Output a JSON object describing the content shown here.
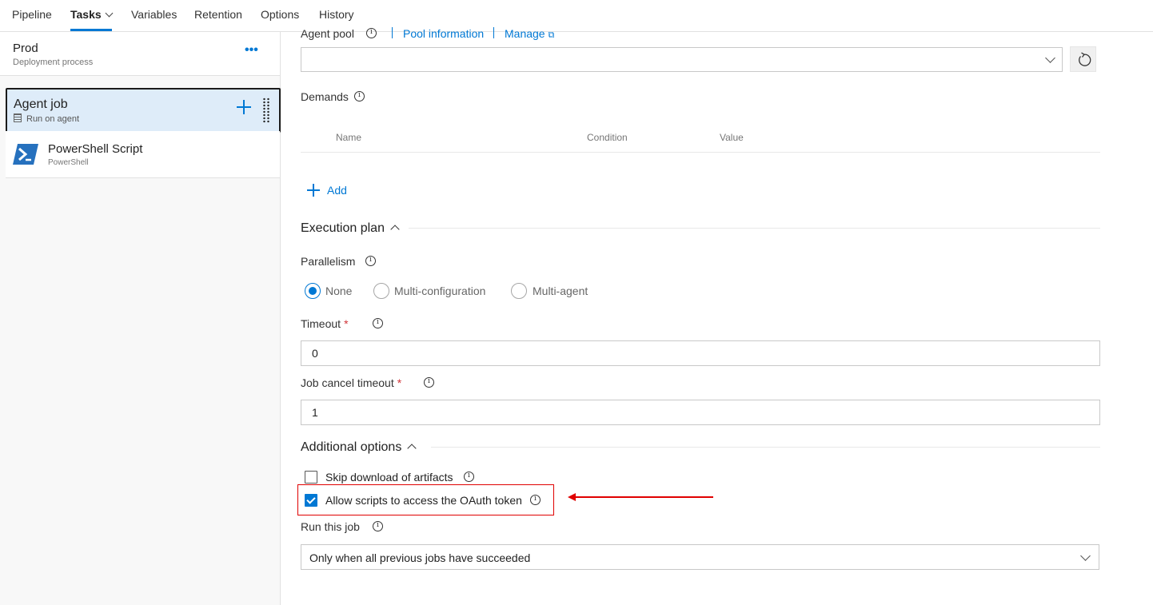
{
  "tabs": [
    {
      "label": "Pipeline"
    },
    {
      "label": "Tasks"
    },
    {
      "label": "Variables"
    },
    {
      "label": "Retention"
    },
    {
      "label": "Options"
    },
    {
      "label": "History"
    }
  ],
  "active_tab": "Tasks",
  "left": {
    "stage_name": "Prod",
    "stage_sub": "Deployment process",
    "more_icon": "ellipsis-icon",
    "agent_job": {
      "title": "Agent job",
      "subtitle": "Run on agent"
    },
    "task": {
      "title": "PowerShell Script",
      "subtitle": "PowerShell"
    }
  },
  "agent_pool": {
    "label": "Agent pool",
    "pool_info_link": "Pool information",
    "manage_link": "Manage",
    "value": ""
  },
  "demands": {
    "label": "Demands",
    "columns": [
      "Name",
      "Condition",
      "Value"
    ],
    "add_label": "Add"
  },
  "execution_plan": {
    "title": "Execution plan",
    "parallelism_label": "Parallelism",
    "options": [
      "None",
      "Multi-configuration",
      "Multi-agent"
    ],
    "selected": "None",
    "timeout_label": "Timeout",
    "timeout_value": "0",
    "cancel_timeout_label": "Job cancel timeout",
    "cancel_timeout_value": "1",
    "required_marker": "*"
  },
  "additional_options": {
    "title": "Additional options",
    "skip_download_label": "Skip download of artifacts",
    "skip_download_checked": false,
    "allow_oauth_label": "Allow scripts to access the OAuth token",
    "allow_oauth_checked": true,
    "run_this_job_label": "Run this job",
    "run_this_job_value": "Only when all previous jobs have succeeded"
  },
  "colors": {
    "accent": "#0078d4",
    "annotation": "#e00000",
    "selected_bg": "#deecf9"
  }
}
